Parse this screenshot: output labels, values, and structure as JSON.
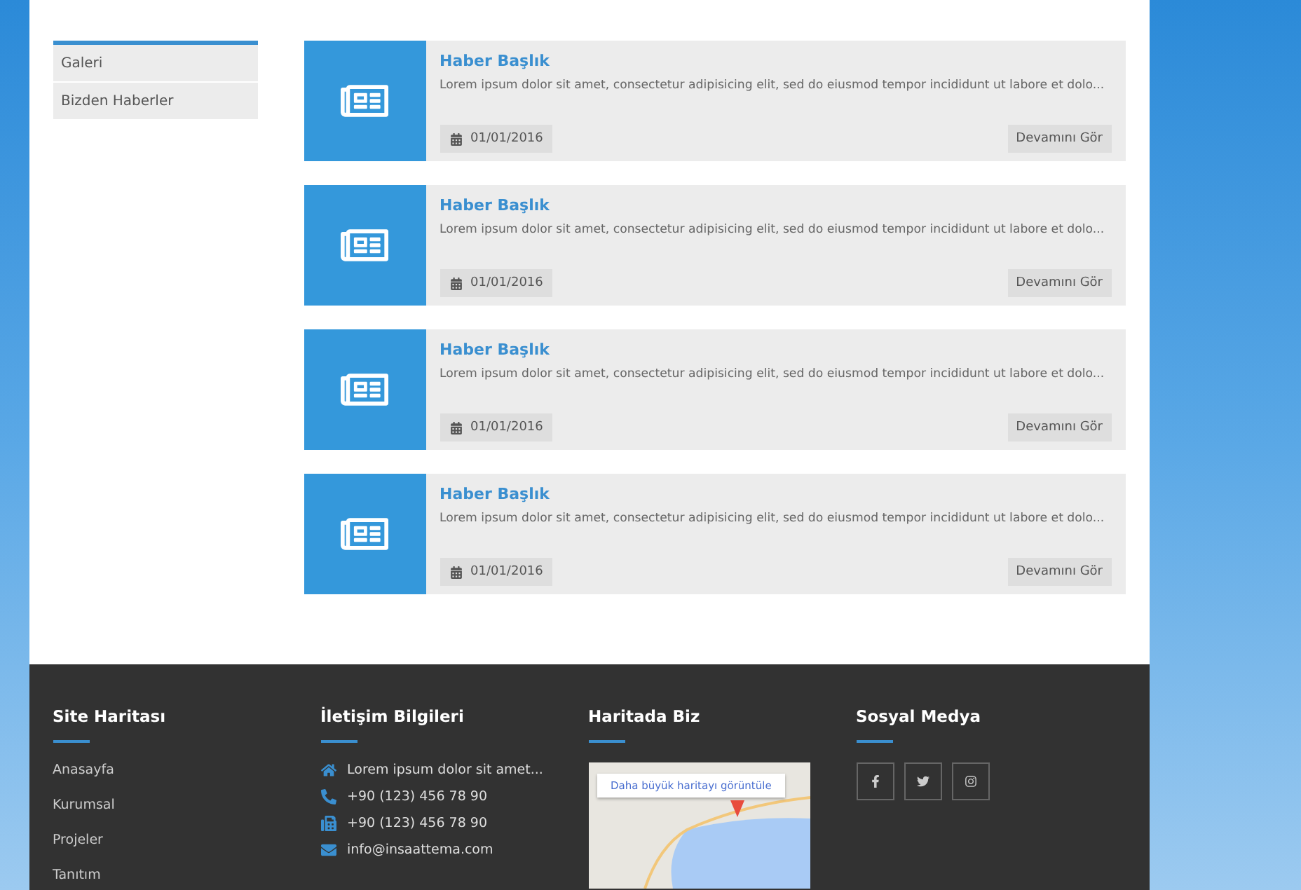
{
  "sidebar": {
    "items": [
      {
        "label": "Galeri",
        "selected": false
      },
      {
        "label": "Bizden Haberler",
        "selected": false
      }
    ]
  },
  "news": [
    {
      "title": "Haber Başlık",
      "excerpt": "Lorem ipsum dolor sit amet, consectetur adipisicing elit, sed do eiusmod tempor incididunt ut labore et dolo...",
      "date": "01/01/2016",
      "button": "Devamını Gör"
    },
    {
      "title": "Haber Başlık",
      "excerpt": "Lorem ipsum dolor sit amet, consectetur adipisicing elit, sed do eiusmod tempor incididunt ut labore et dolo...",
      "date": "01/01/2016",
      "button": "Devamını Gör"
    },
    {
      "title": "Haber Başlık",
      "excerpt": "Lorem ipsum dolor sit amet, consectetur adipisicing elit, sed do eiusmod tempor incididunt ut labore et dolo...",
      "date": "01/01/2016",
      "button": "Devamını Gör"
    },
    {
      "title": "Haber Başlık",
      "excerpt": "Lorem ipsum dolor sit amet, consectetur adipisicing elit, sed do eiusmod tempor incididunt ut labore et dolo...",
      "date": "01/01/2016",
      "button": "Devamını Gör"
    }
  ],
  "footer": {
    "sitemap": {
      "title": "Site Haritası",
      "links": [
        "Anasayfa",
        "Kurumsal",
        "Projeler",
        "Tanıtım"
      ]
    },
    "contact": {
      "title": "İletişim Bilgileri",
      "items": [
        {
          "kind": "address",
          "text": "Lorem ipsum dolor sit amet..."
        },
        {
          "kind": "phone",
          "text": "+90 (123) 456 78 90"
        },
        {
          "kind": "fax",
          "text": "+90 (123) 456 78 90"
        },
        {
          "kind": "email",
          "text": "info@insaattema.com"
        }
      ]
    },
    "map": {
      "title": "Haritada Biz",
      "link": "Daha büyük haritayı görüntüle"
    },
    "social": {
      "title": "Sosyal Medya",
      "links": [
        {
          "kind": "facebook"
        },
        {
          "kind": "twitter"
        },
        {
          "kind": "instagram"
        }
      ]
    }
  }
}
